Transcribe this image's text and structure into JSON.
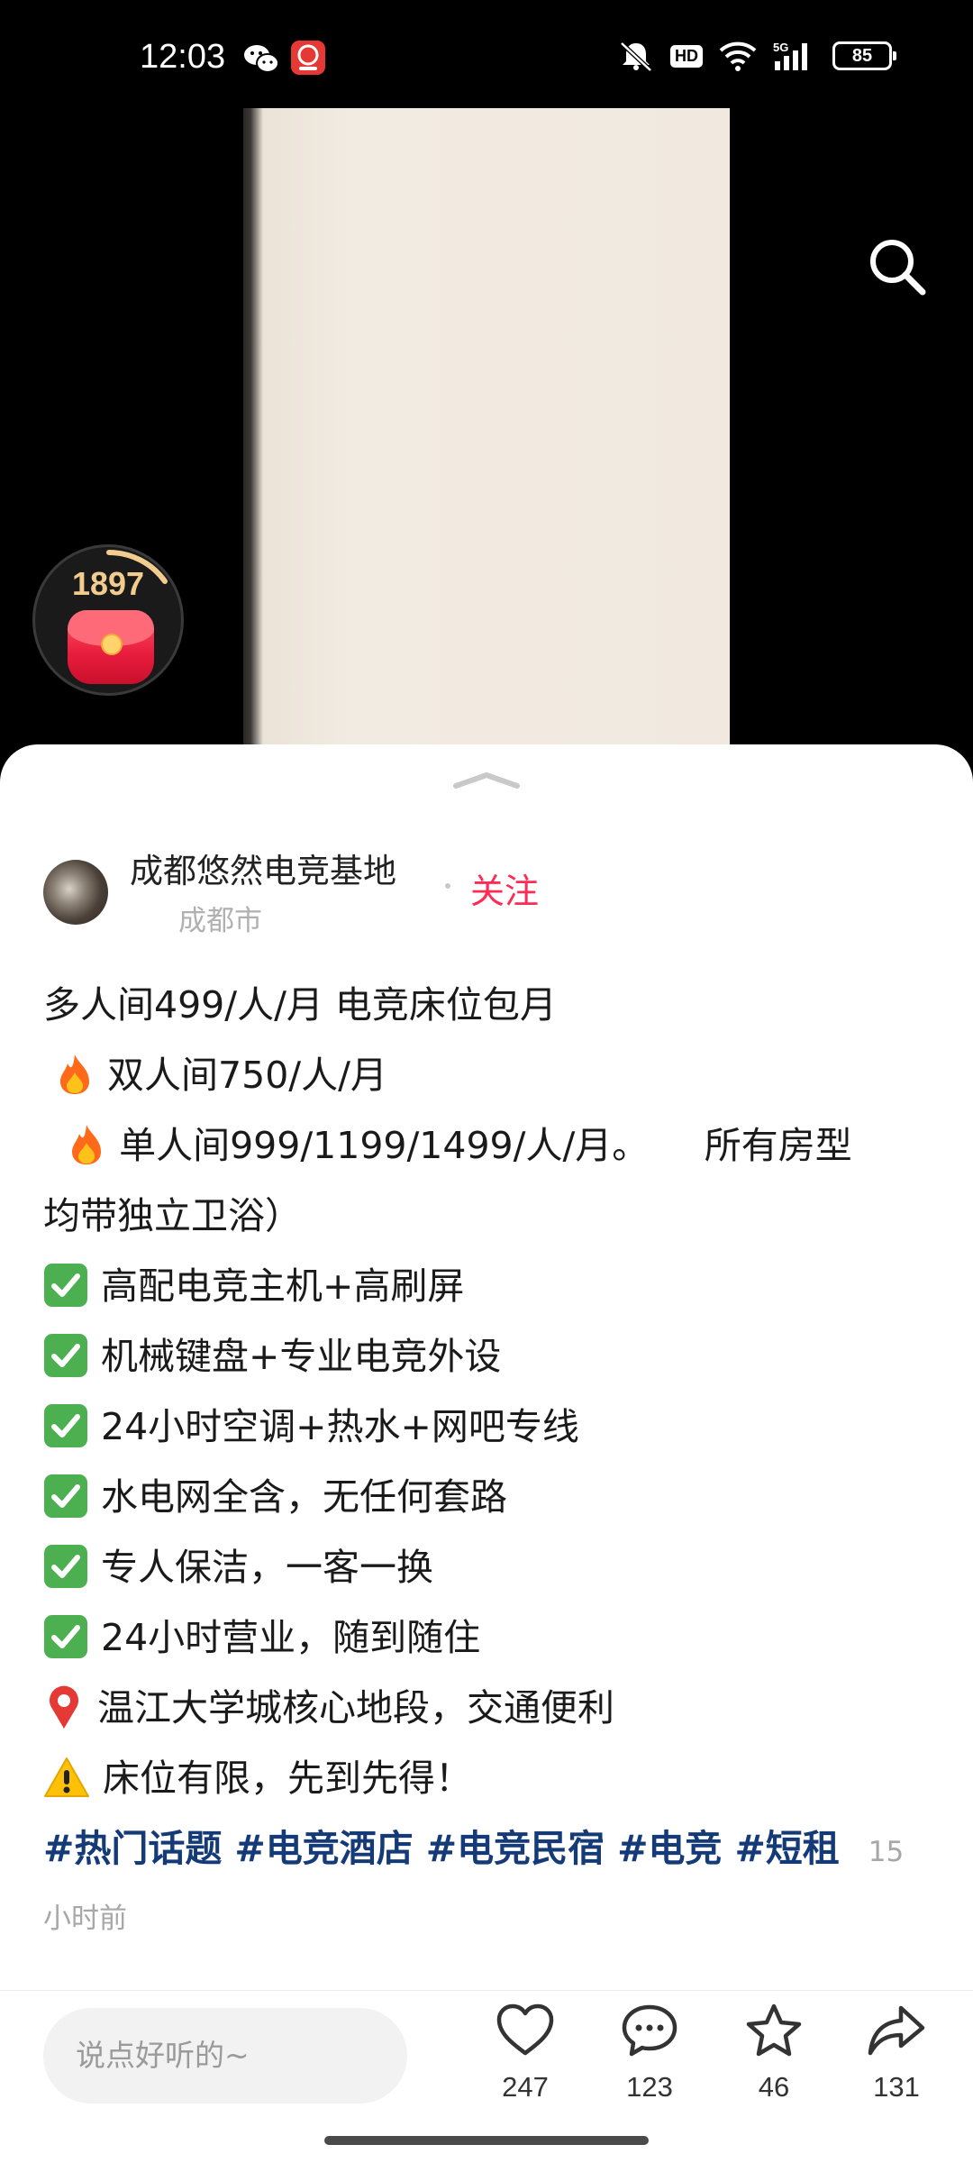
{
  "status_bar": {
    "time": "12:03",
    "battery": "85",
    "network": "5G",
    "hd": "HD"
  },
  "redpacket": {
    "count": "1897"
  },
  "post": {
    "author": "成都悠然电竞基地",
    "location": "成都市",
    "follow_label": "关注",
    "lines": [
      "多人间499/人/月 电竞床位包月",
      "双人间750/人/月",
      "单人间999/1199/1499/人/月。　　所有房型",
      "均带独立卫浴）",
      "高配电竞主机+高刷屏",
      "机械键盘+专业电竞外设",
      "24小时空调+热水+网吧专线",
      "水电网全含，无任何套路",
      "专人保洁，一客一换",
      "24小时营业，随到随住",
      "温江大学城核心地段，交通便利",
      "床位有限，先到先得！"
    ],
    "tags": [
      "#热门话题",
      "#电竞酒店",
      "#电竞民宿",
      "#电竞",
      "#短租"
    ],
    "time_part1": "15",
    "time_part2": "小时前"
  },
  "bottom_bar": {
    "comment_placeholder": "说点好听的~",
    "likes": "247",
    "comments": "123",
    "favorites": "46",
    "shares": "131"
  },
  "colors": {
    "accent": "#fe2c55",
    "hashtag": "#143b77"
  }
}
